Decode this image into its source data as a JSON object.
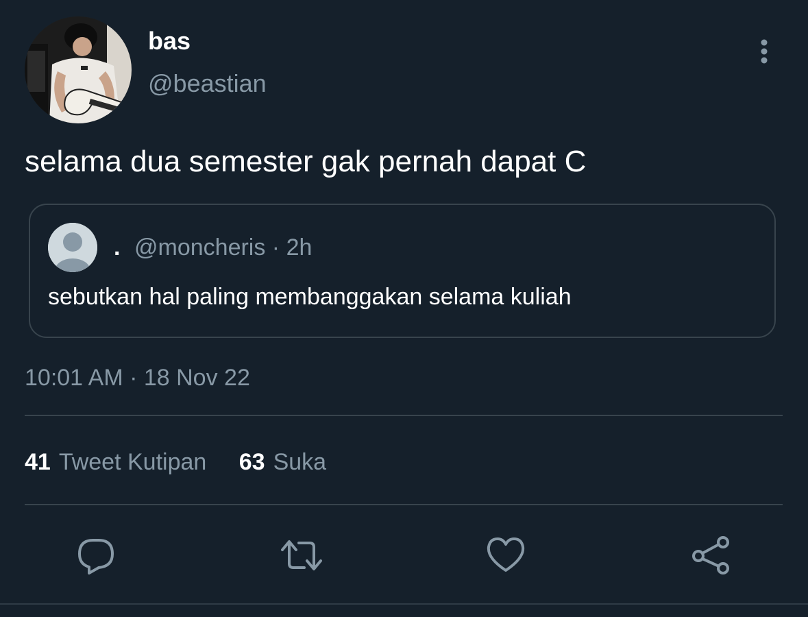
{
  "theme": {
    "background": "#15202b",
    "text_primary": "#ffffff",
    "text_secondary": "#8899a6",
    "border": "#38444d"
  },
  "tweet": {
    "author": {
      "display_name": "bas",
      "handle": "@beastian",
      "avatar_icon": "profile-photo-guitarist"
    },
    "text": "selama dua semester gak pernah dapat C",
    "quoted": {
      "display_name": ".",
      "handle_time": "@moncheris · 2h",
      "avatar_icon": "default-profile-icon",
      "text": "sebutkan hal paling membanggakan selama kuliah"
    },
    "timestamp": "10:01 AM · 18 Nov 22",
    "stats": {
      "quotes_count": "41",
      "quotes_label": "Tweet Kutipan",
      "likes_count": "63",
      "likes_label": "Suka"
    }
  },
  "actions": [
    {
      "name": "reply",
      "icon": "comment-icon"
    },
    {
      "name": "retweet",
      "icon": "retweet-icon"
    },
    {
      "name": "like",
      "icon": "heart-icon"
    },
    {
      "name": "share",
      "icon": "share-icon"
    }
  ]
}
